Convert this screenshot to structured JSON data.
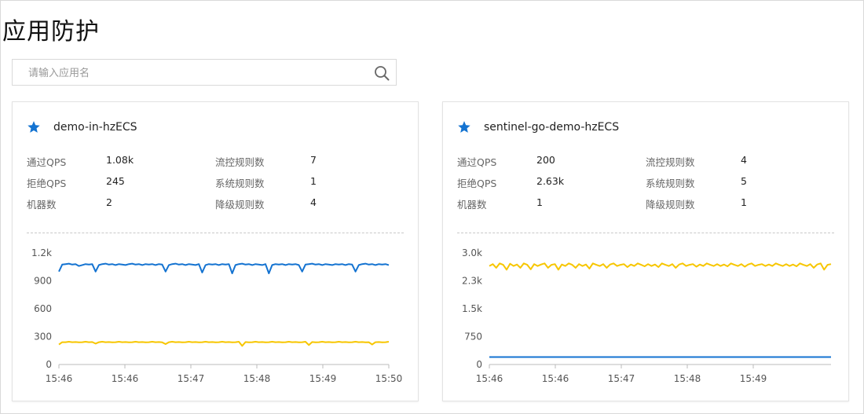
{
  "page": {
    "title": "应用防护"
  },
  "search": {
    "placeholder": "请输入应用名"
  },
  "labels": {
    "pass_qps": "通过QPS",
    "block_qps": "拒绝QPS",
    "machines": "机器数",
    "flow_rules": "流控规则数",
    "system_rules": "系统规则数",
    "degrade_rules": "降级规则数"
  },
  "colors": {
    "pass": "#1473d1",
    "block": "#f7c600",
    "star": "#1473d1"
  },
  "icons": {
    "search": "search-icon",
    "favorite": "star-icon"
  },
  "apps": [
    {
      "name": "demo-in-hzECS",
      "favorite": true,
      "pass_qps": "1.08k",
      "block_qps": "245",
      "machines": "2",
      "flow_rules": "7",
      "system_rules": "1",
      "degrade_rules": "4"
    },
    {
      "name": "sentinel-go-demo-hzECS",
      "favorite": true,
      "pass_qps": "200",
      "block_qps": "2.63k",
      "machines": "1",
      "flow_rules": "4",
      "system_rules": "5",
      "degrade_rules": "1"
    }
  ],
  "chart_data": [
    {
      "type": "line",
      "x": [
        "15:46",
        "15:46",
        "15:47",
        "15:48",
        "15:49",
        "15:50"
      ],
      "ylim": [
        0,
        1200
      ],
      "yticks": [
        "0",
        "300",
        "600",
        "900",
        "1.2k"
      ],
      "grid": false,
      "series": [
        {
          "color": "#1473d1",
          "values": [
            1000,
            1075,
            1080,
            1085,
            1075,
            1080,
            1060,
            1070,
            1080,
            1075,
            1080,
            1000,
            1070,
            1080,
            1085,
            1075,
            1080,
            1070,
            1080,
            1075,
            1070,
            1080,
            1085,
            1075,
            1080,
            1070,
            1080,
            1075,
            1080,
            1070,
            1080,
            1075,
            1000,
            1070,
            1080,
            1085,
            1075,
            1080,
            1070,
            1080,
            1075,
            1070,
            1080,
            990,
            1070,
            1080,
            1075,
            1080,
            1070,
            1080,
            1075,
            1080,
            980,
            1070,
            1080,
            1085,
            1075,
            1080,
            1070,
            1080,
            1075,
            1070,
            1080,
            980,
            1070,
            1080,
            1075,
            1080,
            1070,
            1080,
            1075,
            1080,
            1070,
            1000,
            1075,
            1080,
            1085,
            1075,
            1080,
            1070,
            1080,
            1075,
            1070,
            1080,
            1075,
            1080,
            1070,
            1080,
            1075,
            1000,
            1070,
            1080,
            1085,
            1075,
            1080,
            1070,
            1080,
            1075,
            1080,
            1070
          ]
        },
        {
          "color": "#f7c600",
          "values": [
            215,
            240,
            240,
            245,
            240,
            242,
            238,
            240,
            245,
            240,
            242,
            225,
            240,
            245,
            240,
            242,
            238,
            240,
            245,
            240,
            242,
            238,
            240,
            245,
            240,
            242,
            238,
            240,
            245,
            240,
            242,
            238,
            220,
            240,
            245,
            240,
            242,
            238,
            240,
            245,
            240,
            242,
            238,
            240,
            245,
            240,
            242,
            238,
            240,
            245,
            240,
            242,
            238,
            240,
            245,
            200,
            242,
            238,
            240,
            245,
            240,
            242,
            238,
            240,
            245,
            240,
            242,
            238,
            240,
            245,
            240,
            242,
            238,
            240,
            245,
            210,
            242,
            238,
            240,
            245,
            240,
            242,
            238,
            240,
            245,
            240,
            242,
            238,
            240,
            245,
            240,
            242,
            238,
            240,
            215,
            240,
            242,
            238,
            240,
            245
          ]
        }
      ]
    },
    {
      "type": "line",
      "x": [
        "15:46",
        "15:46",
        "15:47",
        "15:48",
        "15:49"
      ],
      "ylim": [
        0,
        3000
      ],
      "yticks": [
        "0",
        "750",
        "1.5k",
        "2.3k",
        "3.0k"
      ],
      "grid": false,
      "series": [
        {
          "color": "#f7c600",
          "values": [
            2650,
            2700,
            2600,
            2720,
            2680,
            2550,
            2710,
            2650,
            2690,
            2600,
            2720,
            2680,
            2560,
            2700,
            2650,
            2690,
            2720,
            2600,
            2680,
            2700,
            2550,
            2690,
            2650,
            2720,
            2680,
            2600,
            2700,
            2650,
            2690,
            2580,
            2720,
            2680,
            2650,
            2700,
            2600,
            2690,
            2720,
            2650,
            2680,
            2700,
            2620,
            2690,
            2650,
            2720,
            2680,
            2640,
            2700,
            2650,
            2690,
            2620,
            2720,
            2680,
            2650,
            2700,
            2600,
            2690,
            2720,
            2650,
            2680,
            2700,
            2630,
            2690,
            2650,
            2720,
            2680,
            2650,
            2700,
            2650,
            2690,
            2640,
            2720,
            2680,
            2650,
            2700,
            2630,
            2690,
            2720,
            2650,
            2680,
            2700,
            2650,
            2690,
            2650,
            2720,
            2680,
            2650,
            2700,
            2650,
            2690,
            2640,
            2720,
            2680,
            2650,
            2700,
            2600,
            2690,
            2720,
            2550,
            2680,
            2700
          ]
        },
        {
          "color": "#1473d1",
          "values": [
            200,
            200,
            200,
            200,
            200,
            200,
            200,
            200,
            200,
            200,
            200,
            200,
            200,
            200,
            200,
            200,
            200,
            200,
            200,
            200,
            200,
            200,
            200,
            200,
            200,
            200,
            200,
            200,
            200,
            200,
            200,
            200,
            200,
            200,
            200,
            200,
            200,
            200,
            200,
            200,
            200,
            200,
            200,
            200,
            200,
            200,
            200,
            200,
            200,
            200
          ]
        }
      ]
    }
  ]
}
